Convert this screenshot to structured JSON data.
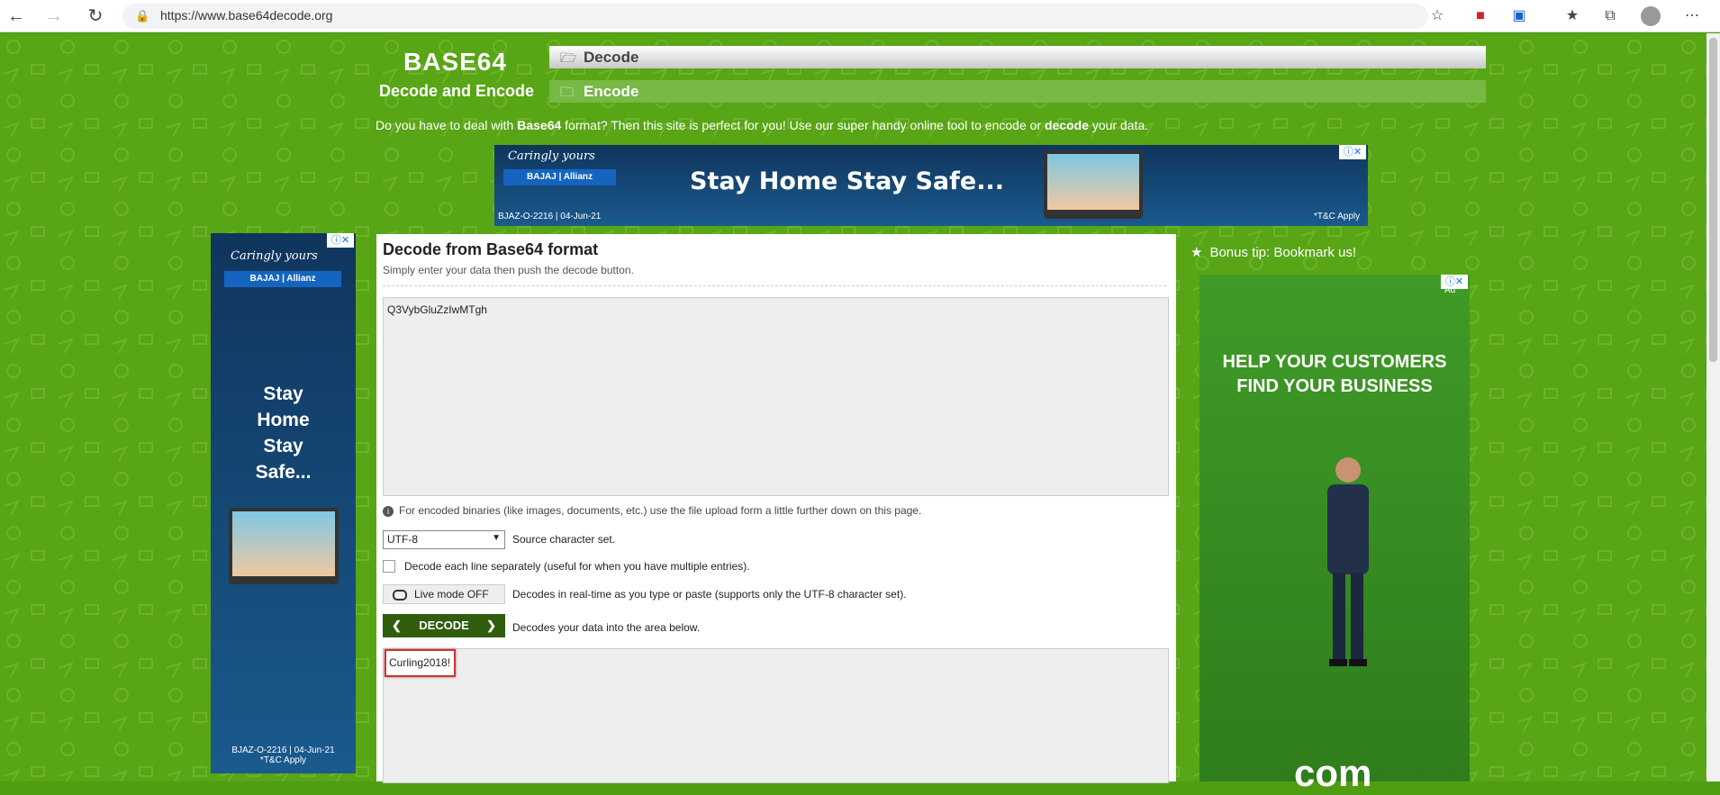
{
  "browser": {
    "url": "https://www.base64decode.org",
    "back_icon": "arrow-left-icon",
    "forward_icon": "arrow-right-icon",
    "reload_icon": "reload-icon"
  },
  "header": {
    "logo_title": "BASE64",
    "logo_subtitle": "Decode and Encode",
    "tabs": [
      {
        "label": "Decode"
      },
      {
        "label": "Encode"
      }
    ],
    "intro_part1": "Do you have to deal with ",
    "intro_bold1": "Base64",
    "intro_part2": " format? Then this site is perfect for you! Use our super handy online tool to encode or ",
    "intro_bold2": "decode",
    "intro_part3": " your data."
  },
  "top_ad": {
    "brand_line": "Caringly yours",
    "brand": "BAJAJ | Allianz",
    "headline": "Stay Home Stay Safe...",
    "footer_left": "BJAZ-O-2216 | 04-Jun-21",
    "footer_right": "*T&C Apply"
  },
  "left_ad": {
    "brand_line": "Caringly yours",
    "brand": "BAJAJ | Allianz",
    "headline_1": "Stay",
    "headline_2": "Home",
    "headline_3": "Stay",
    "headline_4": "Safe...",
    "footer_1": "BJAZ-O-2216 | 04-Jun-21",
    "footer_2": "*T&C Apply"
  },
  "main": {
    "title": "Decode from Base64 format",
    "subtitle": "Simply enter your data then push the decode button.",
    "input_value": "Q3VybGluZzIwMTgh",
    "info_text": "For encoded binaries (like images, documents, etc.) use the file upload form a little further down on this page.",
    "charset_value": "UTF-8",
    "charset_label": "Source character set.",
    "each_line_label": "Decode each line separately (useful for when you have multiple entries).",
    "live_label": "Live mode OFF",
    "live_desc": "Decodes in real-time as you type or paste (supports only the UTF-8 character set).",
    "decode_label": "DECODE",
    "decode_desc": "Decodes your data into the area below.",
    "output_value": "Curling2018!"
  },
  "sidebar": {
    "bonus_text": "Bonus tip: Bookmark us!"
  },
  "right_ad": {
    "ad_label": "Ad",
    "headline_1": "HELP YOUR CUSTOMERS",
    "headline_2": "FIND YOUR BUSINESS",
    "footer_text": "com"
  },
  "colors": {
    "page_bg": "#58a516",
    "decode_button": "#2f5d0c",
    "highlight_border": "#d32f2f"
  }
}
